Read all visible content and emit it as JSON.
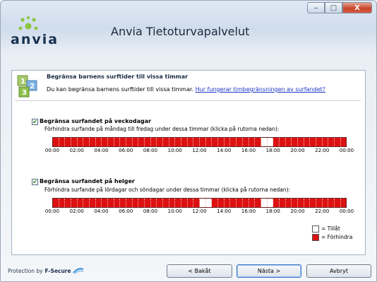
{
  "window": {
    "title": "Anvia Tietoturvapalvelut",
    "logo_text": "anvia",
    "controls": {
      "minimize": "‒",
      "maximize": "□",
      "close": "X"
    }
  },
  "section": {
    "title": "Begränsa barnens surftider till vissa timmar",
    "description": "Du kan begränsa barnens surftider till vissa timmar. ",
    "help_link": "Hur fungerar timbegränsningen av surfandet?"
  },
  "weekdays": {
    "checked": true,
    "label": "Begränsa surfandet på veckodagar",
    "instructions": "Förhindra surfande på måndag till fredag under dessa timmar (klicka på rutorna nedan):",
    "allowed_slots_half_hour": [
      34,
      35
    ]
  },
  "weekend": {
    "checked": true,
    "label": "Begränsa surfandet på helger",
    "instructions": "Förhindra surfande på lördagar och söndagar under dessa timmar (klicka på rutorna nedan):",
    "allowed_slots_half_hour": [
      24,
      25,
      34,
      35
    ]
  },
  "axis_labels": [
    "00:00",
    "02:00",
    "04:00",
    "06:00",
    "08:00",
    "10:00",
    "12:00",
    "14:00",
    "16:00",
    "18:00",
    "20:00",
    "22:00",
    "00:00"
  ],
  "legend": {
    "allow": "= Tillåt",
    "block": "= Förhindra",
    "allow_color": "#ffffff",
    "block_color": "#dd1111"
  },
  "footer": {
    "brand_prefix": "Protection by",
    "brand_name": "F-Secure",
    "back_button": "< Bakåt",
    "next_button": "Nästa >",
    "cancel_button": "Avbryt"
  }
}
